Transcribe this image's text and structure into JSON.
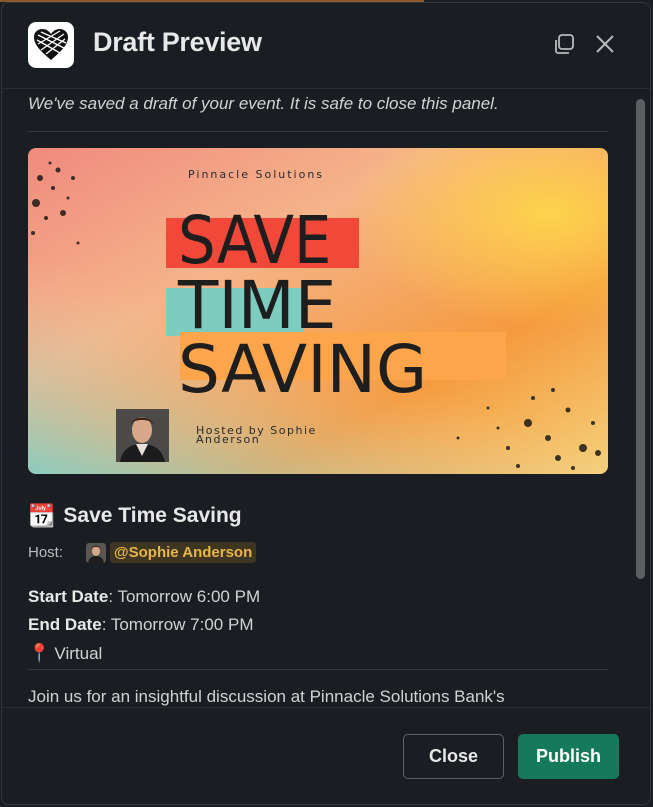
{
  "header": {
    "title": "Draft Preview",
    "app_icon": "heart-knot-logo",
    "copy_icon": "copy-window-icon",
    "close_icon": "close-icon"
  },
  "notice": "We've saved a draft of your event. It is safe to close this panel.",
  "banner": {
    "company": "Pinnacle Solutions",
    "line1": "SAVE",
    "line2": "TIME",
    "line3": "SAVING",
    "hosted_by": "Hosted by Sophie Anderson",
    "colors": {
      "red_bar": "#f2483a",
      "teal_bar": "#7ccdc0",
      "orange_bar": "#fda54a"
    }
  },
  "event": {
    "emoji": "📆",
    "title": "Save Time Saving",
    "host_label": "Host:",
    "host_mention": "@Sophie Anderson",
    "start_label": "Start Date",
    "start_value": ": Tomorrow 6:00 PM",
    "end_label": "End Date",
    "end_value": ": Tomorrow 7:00 PM",
    "location_emoji": "📍",
    "location": "Virtual",
    "description": "Join us for an insightful discussion at Pinnacle Solutions Bank's"
  },
  "footer": {
    "close_label": "Close",
    "publish_label": "Publish"
  },
  "colors": {
    "background": "#1a1d21",
    "mention_text": "#e8b54a",
    "publish": "#157a5a"
  }
}
